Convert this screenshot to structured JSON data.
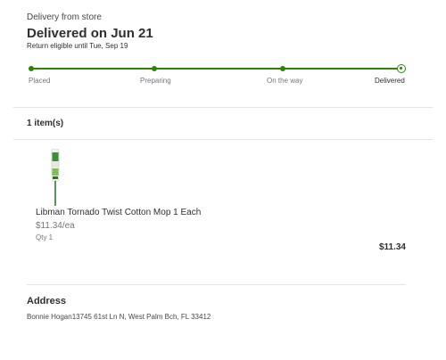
{
  "header": {
    "subtitle": "Delivery from store",
    "title": "Delivered on Jun 21",
    "return_note": "Return eligible until Tue, Sep 19"
  },
  "tracker": {
    "steps": [
      {
        "label": "Placed"
      },
      {
        "label": "Preparing"
      },
      {
        "label": "On the way"
      },
      {
        "label": "Delivered"
      }
    ],
    "current_step": "Delivered",
    "color": "#2a8703"
  },
  "items": {
    "count_label": "1 item(s)",
    "list": [
      {
        "name": "Libman Tornado Twist Cotton Mop 1 Each",
        "unit_price": "$11.34/ea",
        "qty": "Qty 1",
        "total": "$11.34",
        "image_icon": "mop-image"
      }
    ]
  },
  "address": {
    "heading": "Address",
    "text": "Bonnie Hogan13745 61st Ln N, West Palm Bch, FL 33412"
  }
}
